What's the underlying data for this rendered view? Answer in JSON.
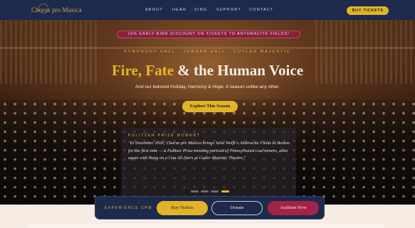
{
  "brand": {
    "logo_text": "Chorus pro Musica"
  },
  "nav": {
    "items": [
      "ABOUT",
      "HEAR",
      "SING",
      "SUPPORT",
      "CONTACT"
    ]
  },
  "header": {
    "cta_label": "BUY TICKETS"
  },
  "hero": {
    "promo_banner": "15% EARLY BIRD DISCOUNT ON TICKETS TO ANTHRACITE FIELDS!",
    "venues": "SYMPHONY HALL · JORDAN HALL · CUTLER MAJESTIC",
    "headline_part1": "Fire, Fate",
    "headline_part2": "& the Human Voice",
    "subline": "And our beloved Holiday, Harmony & Hope. A season unlike any other.",
    "cta_label": "Explore This Season"
  },
  "feature": {
    "tag": "PULITZER PRIZE MOMENT",
    "text": "\"In November 2026, Chorus pro Musica brings Julia Wolfe's Anthracite Fields to Boston for the first time — a Pulitzer Prize-winning portrait of Pennsylvania coal miners, alive again with Bang on a Can All-Stars at Cutler Majestic Theatre.\""
  },
  "carousel": {
    "total": 4,
    "active_index": 3
  },
  "experience_bar": {
    "label": "EXPERIENCE CPM",
    "buy_label": "Buy Tickets",
    "donate_label": "Donate",
    "audition_label": "Audition Now"
  },
  "colors": {
    "navy": "#1e2a4c",
    "gold": "#e2b326",
    "crimson": "#a12346",
    "cream": "#f7ece4"
  }
}
